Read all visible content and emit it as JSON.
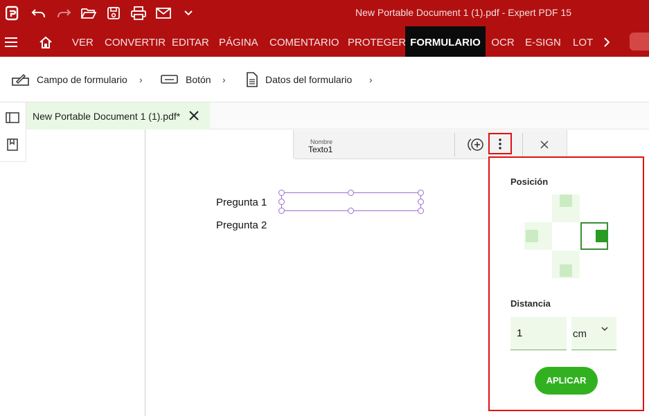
{
  "window": {
    "title": "New Portable Document 1 (1).pdf   -   Expert PDF 15"
  },
  "quick_access": {
    "icons": [
      "app-logo-icon",
      "undo-icon",
      "redo-icon",
      "open-folder-icon",
      "save-icon",
      "print-icon",
      "mail-icon",
      "customize-chevron-icon"
    ]
  },
  "menu": {
    "tabs": [
      "VER",
      "CONVERTIR",
      "EDITAR",
      "PÁGINA",
      "COMENTARIO",
      "PROTEGER",
      "FORMULARIO",
      "OCR",
      "E-SIGN",
      "LOT"
    ],
    "active_tab": "FORMULARIO"
  },
  "toolbar": {
    "items": [
      {
        "label": "Campo de formulario",
        "icon": "form-field-icon"
      },
      {
        "label": "Botón",
        "icon": "button-icon"
      },
      {
        "label": "Datos del formulario",
        "icon": "form-data-icon"
      }
    ]
  },
  "document_tab": {
    "label": "New Portable Document 1 (1).pdf*"
  },
  "document": {
    "question_1": "Pregunta 1",
    "question_2": "Pregunta 2"
  },
  "field_toolbar": {
    "name_label": "Nombre",
    "name_value": "Texto1"
  },
  "position_popup": {
    "position_heading": "Posición",
    "selected_position": "right",
    "distance_heading": "Distancia",
    "distance_value": "1",
    "unit_value": "cm",
    "apply_label": "APLICAR"
  },
  "colors": {
    "brand_red": "#b21010",
    "active_tab_bg": "#0b0b0b",
    "accent_green": "#32b120",
    "highlight_red": "#e01010",
    "field_selection": "#9b6fd0"
  }
}
